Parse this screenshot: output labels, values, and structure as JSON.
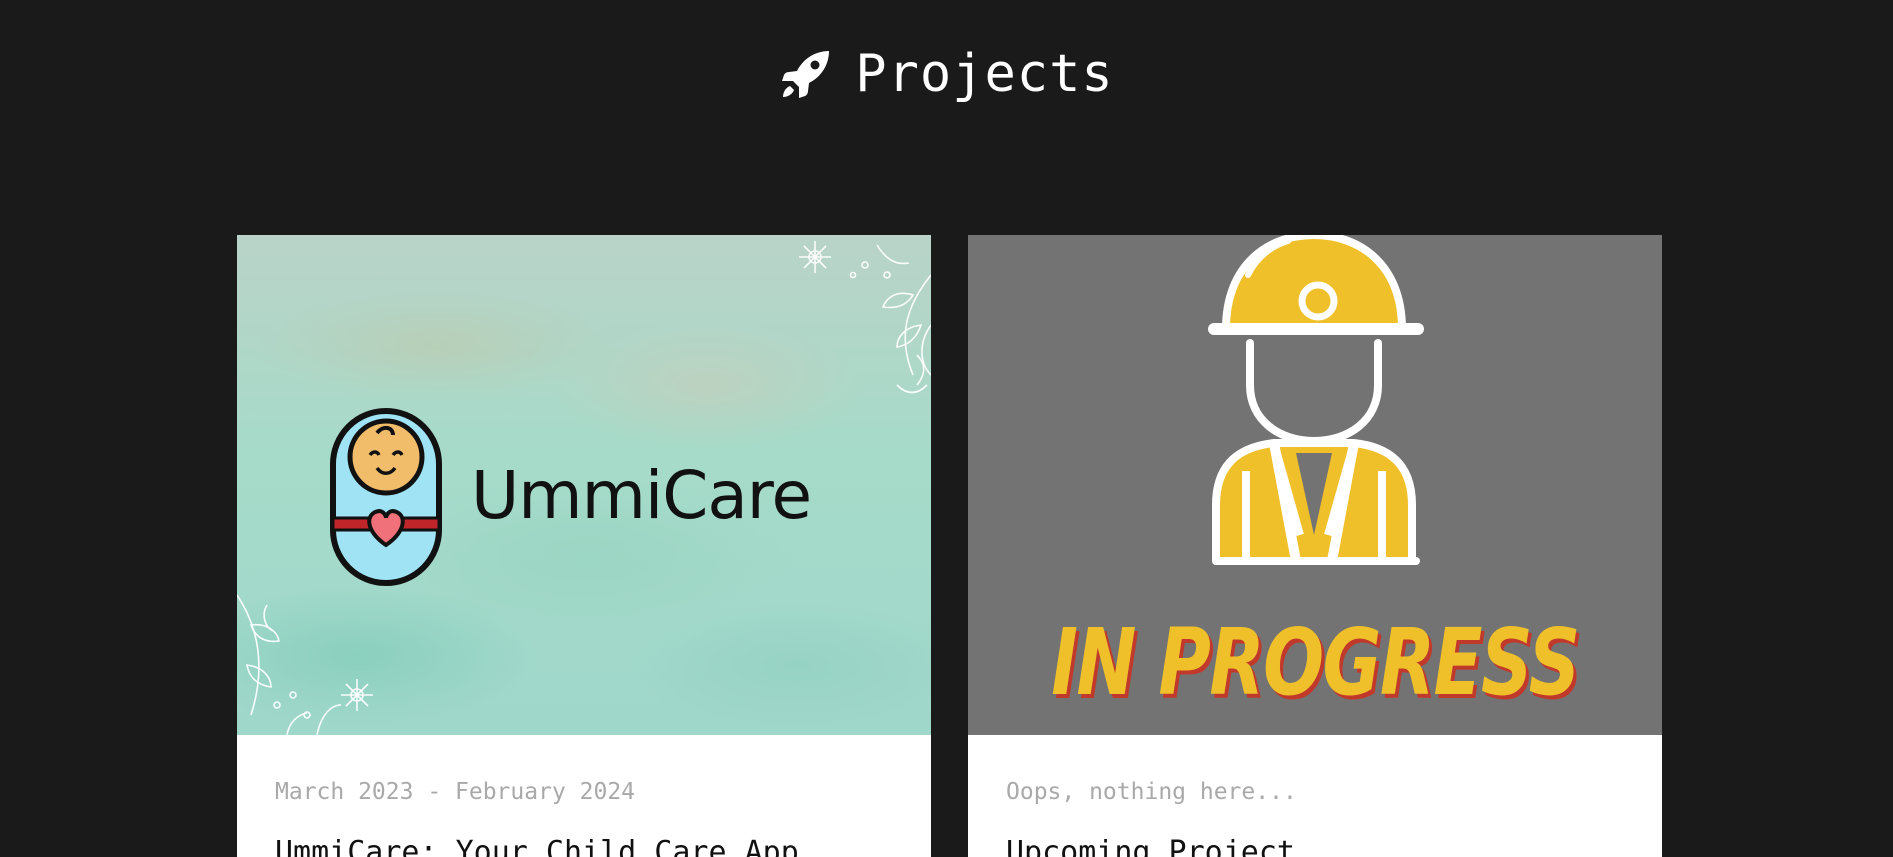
{
  "section": {
    "title": "Projects",
    "icon": "rocket-icon"
  },
  "projects": [
    {
      "date": "March 2023 - February 2024",
      "title": "UmmiCare: Your Child Care App",
      "logo_text": "UmmiCare",
      "image_icon": "baby-icon",
      "image_bg_color": "#a6dbc9"
    },
    {
      "date": "Oops, nothing here...",
      "title": "Upcoming Project",
      "banner_text": "IN PROGRESS",
      "image_icon": "construction-worker-icon",
      "image_bg_color": "#737373",
      "accent_color": "#f0c02a"
    }
  ]
}
